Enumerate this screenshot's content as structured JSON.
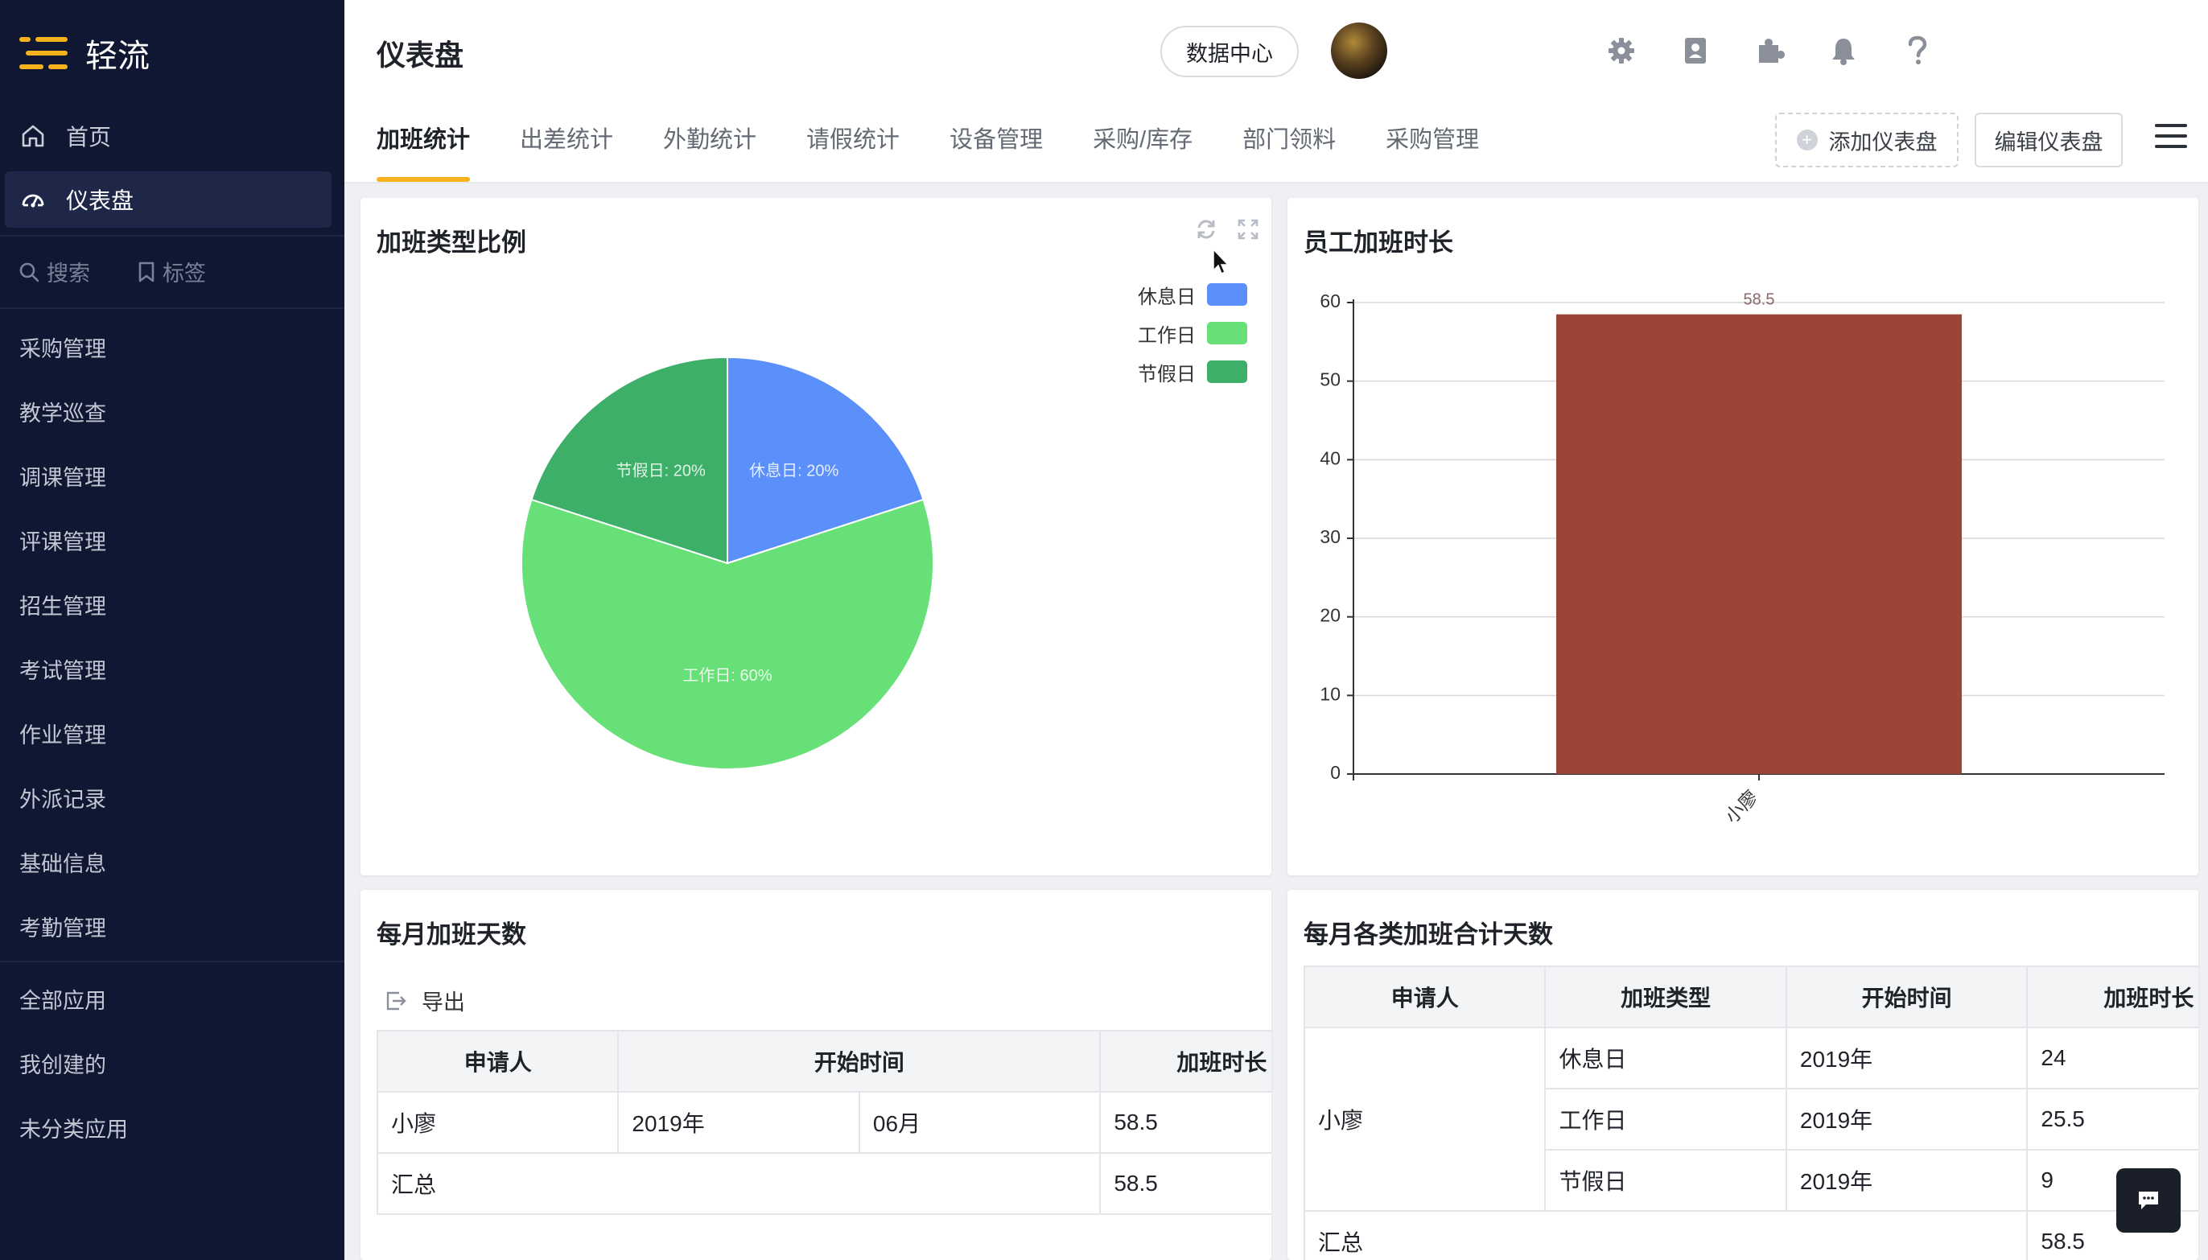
{
  "app": {
    "name": "轻流"
  },
  "sidebar": {
    "nav": [
      {
        "label": "首页",
        "icon": "home-icon"
      },
      {
        "label": "仪表盘",
        "icon": "dashboard-icon",
        "active": true
      }
    ],
    "search_label": "搜索",
    "tags_label": "标签",
    "apps": [
      "采购管理",
      "教学巡查",
      "调课管理",
      "评课管理",
      "招生管理",
      "考试管理",
      "作业管理",
      "外派记录",
      "基础信息",
      "考勤管理"
    ],
    "groups": [
      "全部应用",
      "我创建的",
      "未分类应用"
    ]
  },
  "header": {
    "title": "仪表盘",
    "data_center_label": "数据中心",
    "tabs": [
      "加班统计",
      "出差统计",
      "外勤统计",
      "请假统计",
      "设备管理",
      "采购/库存",
      "部门领料",
      "采购管理"
    ],
    "active_tab": 0,
    "add_dashboard_label": "添加仪表盘",
    "edit_dashboard_label": "编辑仪表盘"
  },
  "pie_card": {
    "title": "加班类型比例",
    "legend": [
      {
        "label": "休息日",
        "color": "#5b8ff9"
      },
      {
        "label": "工作日",
        "color": "#66e077"
      },
      {
        "label": "节假日",
        "color": "#3daf69"
      }
    ]
  },
  "bar_card": {
    "title": "员工加班时长"
  },
  "chart_data": [
    {
      "type": "pie",
      "title": "加班类型比例",
      "slices": [
        {
          "label": "休息日",
          "value": 20,
          "text": "休息日: 20%",
          "color": "#5b8ff9"
        },
        {
          "label": "工作日",
          "value": 60,
          "text": "工作日: 60%",
          "color": "#66e077"
        },
        {
          "label": "节假日",
          "value": 20,
          "text": "节假日: 20%",
          "color": "#3daf69"
        }
      ]
    },
    {
      "type": "bar",
      "title": "员工加班时长",
      "categories": [
        "小廖"
      ],
      "values": [
        58.5
      ],
      "value_labels": [
        "58.5"
      ],
      "ylim": [
        0,
        60
      ],
      "yticks": [
        0,
        10,
        20,
        30,
        40,
        50,
        60
      ],
      "color": "#9b4538",
      "grid": true
    }
  ],
  "monthly_days": {
    "title": "每月加班天数",
    "export_label": "导出",
    "headers": [
      "申请人",
      "开始时间",
      "加班时长"
    ],
    "row": {
      "applicant": "小廖",
      "year": "2019年",
      "month": "06月",
      "hours": "58.5"
    },
    "total": {
      "label": "汇总",
      "hours": "58.5"
    }
  },
  "monthly_type_days": {
    "title": "每月各类加班合计天数",
    "headers": [
      "申请人",
      "加班类型",
      "开始时间",
      "加班时长"
    ],
    "applicant": "小廖",
    "rows": [
      {
        "type": "休息日",
        "year": "2019年",
        "hours": "24"
      },
      {
        "type": "工作日",
        "year": "2019年",
        "hours": "25.5"
      },
      {
        "type": "节假日",
        "year": "2019年",
        "hours": "9"
      }
    ],
    "total": {
      "label": "汇总",
      "hours": "58.5"
    }
  }
}
